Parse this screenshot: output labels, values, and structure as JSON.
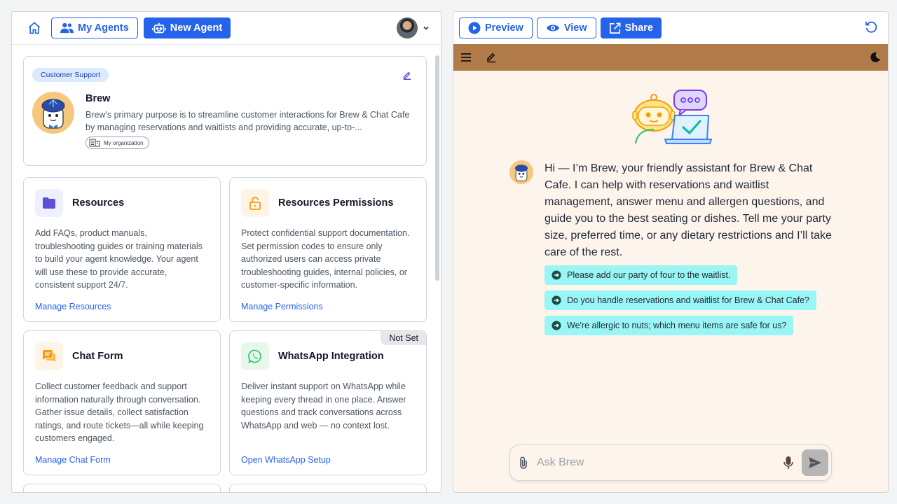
{
  "left": {
    "nav": {
      "my_agents_label": "My Agents",
      "new_agent_label": "New Agent"
    },
    "agent": {
      "tag": "Customer Support",
      "name": "Brew",
      "description": "Brew's primary purpose is to streamline customer interactions for Brew & Chat Cafe by managing reservations and waitlists and providing accurate, up-to-...",
      "org_label": "My organization"
    },
    "cards": [
      {
        "title": "Resources",
        "description": "Add FAQs, product manuals, troubleshooting guides or training materials to build your agent knowledge. Your agent will use these to provide accurate, consistent support 24/7.",
        "link": "Manage Resources",
        "icon": "folder-icon",
        "icon_color": "#5b4fd6"
      },
      {
        "title": "Resources Permissions",
        "description": "Protect confidential support documentation. Set permission codes to ensure only authorized users can access private troubleshooting guides, internal policies, or customer-specific information.",
        "link": "Manage Permissions",
        "icon": "lock-icon",
        "icon_color": "#f59e0b"
      },
      {
        "title": "Chat Form",
        "description": "Collect customer feedback and support information naturally through conversation. Gather issue details, collect satisfaction ratings, and route tickets—all while keeping customers engaged.",
        "link": "Manage Chat Form",
        "icon": "chat-bubbles-icon",
        "icon_color": "#f59e0b"
      },
      {
        "title": "WhatsApp Integration",
        "description": "Deliver instant support on WhatsApp while keeping every thread in one place. Answer questions and track conversations across WhatsApp and web — no context lost.",
        "link": "Open WhatsApp Setup",
        "badge": "Not Set",
        "icon": "whatsapp-icon",
        "icon_color": "#22c55e"
      }
    ]
  },
  "right": {
    "toolbar": {
      "preview_label": "Preview",
      "view_label": "View",
      "share_label": "Share"
    },
    "chat": {
      "greeting": "Hi — I’m Brew, your friendly assistant for Brew & Chat Cafe. I can help with reservations and waitlist management, answer menu and allergen questions, and guide you to the best seating or dishes. Tell me your party size, preferred time, or any dietary restrictions and I’ll take care of the rest.",
      "suggestions": [
        "Please add our party of four to the waitlist.",
        "Do you handle reservations and waitlist for Brew & Chat Cafe?",
        "We're allergic to nuts; which menu items are safe for us?"
      ],
      "input_placeholder": "Ask Brew"
    }
  },
  "colors": {
    "primary": "#2563eb",
    "brown_bar": "#b07a49",
    "chat_bg": "#fdf4ec",
    "suggestion_bg": "#99f6f5"
  }
}
